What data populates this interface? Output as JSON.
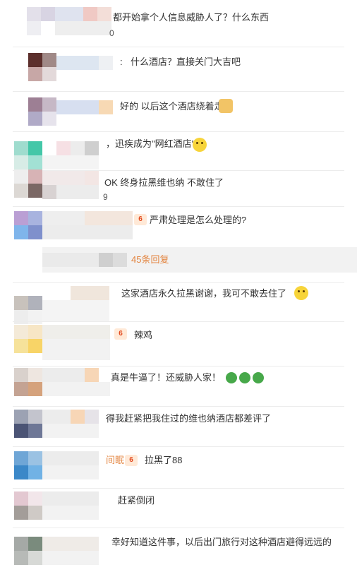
{
  "comments": [
    {
      "prefix": "",
      "text": "都开始拿个人信息威胁人了？什么东西",
      "meta": "0"
    },
    {
      "prefix": ":",
      "text": "什么酒店？直接关门大吉吧",
      "meta": ""
    },
    {
      "prefix": "",
      "text": "好的 以后这个酒店绕着走",
      "meta": ""
    },
    {
      "prefix": "",
      "text": "，迅疾成为\"网红酒店\"了",
      "meta": ""
    },
    {
      "prefix": "",
      "text": "OK 终身拉黑维也纳 不敢住了",
      "meta": "9"
    },
    {
      "prefix": "",
      "text": "严肃处理是怎么处理的?",
      "meta": ""
    },
    {
      "prefix": "",
      "text": "这家酒店永久拉黑谢谢，我可不敢去住了",
      "meta": ""
    },
    {
      "prefix": "",
      "text": "辣鸡",
      "meta": ""
    },
    {
      "prefix": "",
      "text": "真是牛逼了！还威胁人家！",
      "meta": ""
    },
    {
      "prefix": "",
      "text": "得我赶紧把我住过的维也纳酒店都差评了",
      "meta": ""
    },
    {
      "prefix": "间眠",
      "text": "拉黑了88",
      "meta": ""
    },
    {
      "prefix": "",
      "text": "赶紧倒闭",
      "meta": ""
    },
    {
      "prefix": "",
      "text": "幸好知道这件事，以后出门旅行对这种酒店避得远远的",
      "meta": ""
    }
  ],
  "reply": {
    "label": "45条回复"
  },
  "badges": {
    "vip": "6"
  },
  "icons": {
    "emoji": "smile-emoji-icon",
    "clap": "clap-emoji-icon",
    "green": "green-face-icon"
  },
  "colors": {
    "accent": "#e3833d",
    "divider": "#ececec"
  }
}
